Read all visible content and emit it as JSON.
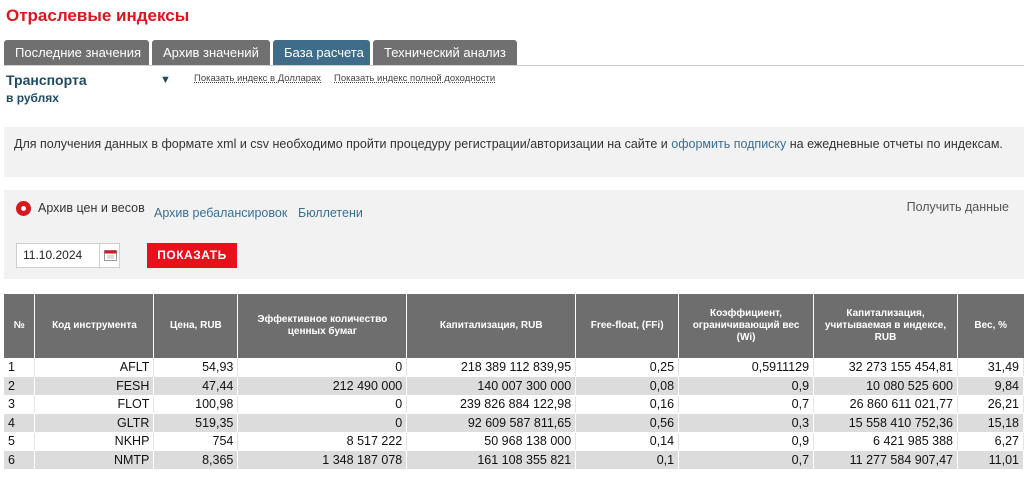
{
  "page_title": "Отраслевые индексы",
  "tabs": [
    {
      "label": "Последние значения"
    },
    {
      "label": "Архив значений"
    },
    {
      "label": "База расчета"
    },
    {
      "label": "Технический анализ"
    }
  ],
  "index": {
    "name": "Транспорта",
    "subtitle": "в рублях"
  },
  "links": {
    "usd": "Показать индекс в Долларах",
    "total_return": "Показать индекс полной доходности"
  },
  "notice": {
    "text_before": "Для получения данных в формате xml и csv необходимо пройти процедуру регистрации/авторизации на сайте и ",
    "link": "оформить подписку",
    "text_after": " на ежедневные отчеты по индексам."
  },
  "archive": {
    "radio_label": "Архив цен и весов",
    "rebalance_link": "Архив ребалансировок",
    "bulletins_link": "Бюллетени",
    "get_data": "Получить данные",
    "date": "11.10.2024",
    "show_button": "ПОКАЗАТЬ"
  },
  "table": {
    "headers": [
      "№",
      "Код инструмента",
      "Цена, RUB",
      "Эффективное количество ценных бумаг",
      "Капитализация, RUB",
      "Free-float, (FFi)",
      "Коэффициент, ограничивающий вес (Wi)",
      "Капитализация, учитываемая в индексе, RUB",
      "Вес, %"
    ],
    "rows": [
      [
        "1",
        "AFLT",
        "54,93",
        "0",
        "218 389 112 839,95",
        "0,25",
        "0,5911129",
        "32 273 155 454,81",
        "31,49"
      ],
      [
        "2",
        "FESH",
        "47,44",
        "212 490 000",
        "140 007 300 000",
        "0,08",
        "0,9",
        "10 080 525 600",
        "9,84"
      ],
      [
        "3",
        "FLOT",
        "100,98",
        "0",
        "239 826 884 122,98",
        "0,16",
        "0,7",
        "26 860 611 021,77",
        "26,21"
      ],
      [
        "4",
        "GLTR",
        "519,35",
        "0",
        "92 609 587 811,65",
        "0,56",
        "0,3",
        "15 558 410 752,36",
        "15,18"
      ],
      [
        "5",
        "NKHP",
        "754",
        "8 517 222",
        "50 968 138 000",
        "0,14",
        "0,9",
        "6 421 985 388",
        "6,27"
      ],
      [
        "6",
        "NMTP",
        "8,365",
        "1 348 187 078",
        "161 108 355 821",
        "0,1",
        "0,7",
        "11 277 584 907,47",
        "11,01"
      ]
    ]
  },
  "colors": {
    "brand_red": "#d8171e",
    "tab_active": "#3f6c89",
    "tab_inactive": "#707070",
    "link": "#3a6f95"
  }
}
